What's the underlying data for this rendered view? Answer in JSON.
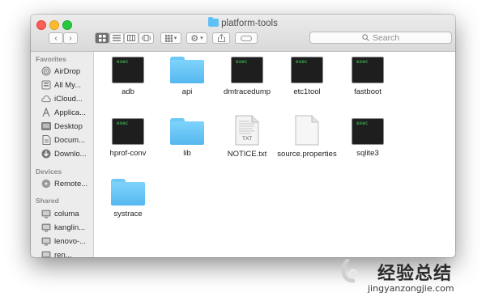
{
  "window": {
    "title": "platform-tools"
  },
  "search": {
    "placeholder": "Search"
  },
  "sidebar": {
    "favorites_heading": "Favorites",
    "favorites": [
      {
        "label": "AirDrop",
        "icon": "airdrop-icon"
      },
      {
        "label": "All My...",
        "icon": "all-my-files-icon"
      },
      {
        "label": "iCloud...",
        "icon": "icloud-icon"
      },
      {
        "label": "Applica...",
        "icon": "applications-icon"
      },
      {
        "label": "Desktop",
        "icon": "desktop-icon"
      },
      {
        "label": "Docum...",
        "icon": "documents-icon"
      },
      {
        "label": "Downlo...",
        "icon": "downloads-icon"
      }
    ],
    "devices_heading": "Devices",
    "devices": [
      {
        "label": "Remote...",
        "icon": "remote-disc-icon"
      }
    ],
    "shared_heading": "Shared",
    "shared": [
      {
        "label": "columa",
        "icon": "network-computer-icon"
      },
      {
        "label": "kanglin...",
        "icon": "network-computer-icon"
      },
      {
        "label": "lenovo-...",
        "icon": "network-computer-icon"
      },
      {
        "label": "ren...",
        "icon": "network-computer-icon"
      }
    ]
  },
  "files": [
    {
      "name": "adb",
      "kind": "exec",
      "exec_label": "exec"
    },
    {
      "name": "api",
      "kind": "folder"
    },
    {
      "name": "dmtracedump",
      "kind": "exec",
      "exec_label": "exec"
    },
    {
      "name": "etc1tool",
      "kind": "exec",
      "exec_label": "exec"
    },
    {
      "name": "fastboot",
      "kind": "exec",
      "exec_label": "exec"
    },
    {
      "name": "hprof-conv",
      "kind": "exec",
      "exec_label": "exec"
    },
    {
      "name": "lib",
      "kind": "folder"
    },
    {
      "name": "NOTICE.txt",
      "kind": "text",
      "doc_label": "TXT"
    },
    {
      "name": "source.properties",
      "kind": "document"
    },
    {
      "name": "sqlite3",
      "kind": "exec",
      "exec_label": "exec"
    },
    {
      "name": "systrace",
      "kind": "folder"
    }
  ],
  "watermark": {
    "text": "经验总结",
    "url": "jingyanzongjie.com"
  },
  "colors": {
    "folder": "#6ec9f7",
    "exec_text": "#3ddc5a",
    "watermark_orange": "#f29a1f"
  }
}
